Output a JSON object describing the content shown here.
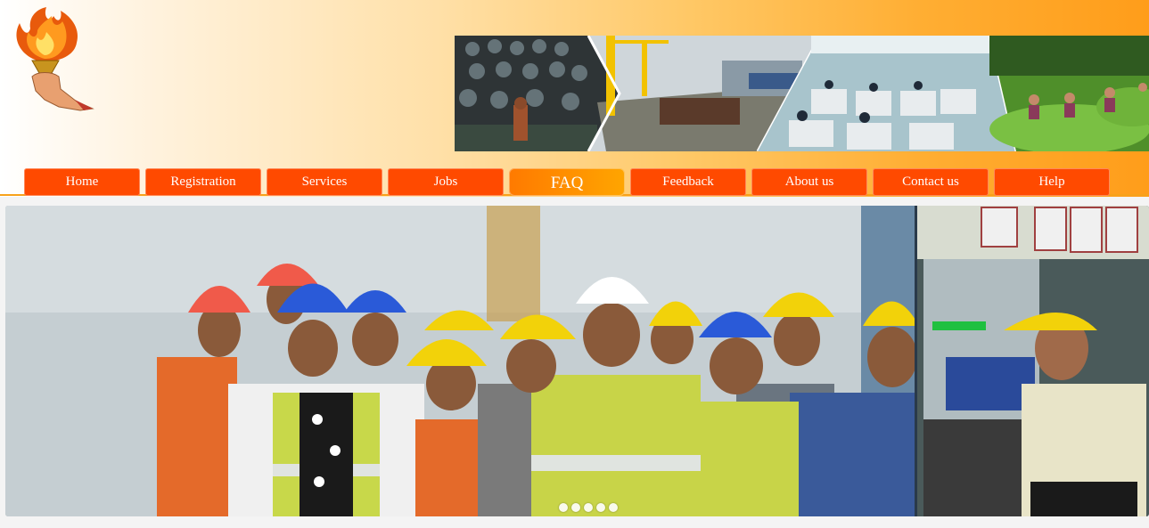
{
  "header": {
    "logo_icon": "torch-logo-icon",
    "banner_panels": [
      "textile-mill",
      "shipyard",
      "office-workspace",
      "tea-plantation"
    ]
  },
  "nav": {
    "items": [
      {
        "label": "Home"
      },
      {
        "label": "Registration"
      },
      {
        "label": "Services"
      },
      {
        "label": "Jobs"
      },
      {
        "label": "FAQ",
        "active": true
      },
      {
        "label": "Feedback"
      },
      {
        "label": "About us"
      },
      {
        "label": "Contact us"
      },
      {
        "label": "Help"
      }
    ]
  },
  "slider": {
    "slide_count": 5,
    "current_slide": 1,
    "scenes": [
      "construction-workers",
      "factory-technician"
    ]
  },
  "colors": {
    "nav_button": "#ff4a00",
    "nav_active": "#ffa500",
    "header_accent": "#ff9d1a"
  }
}
